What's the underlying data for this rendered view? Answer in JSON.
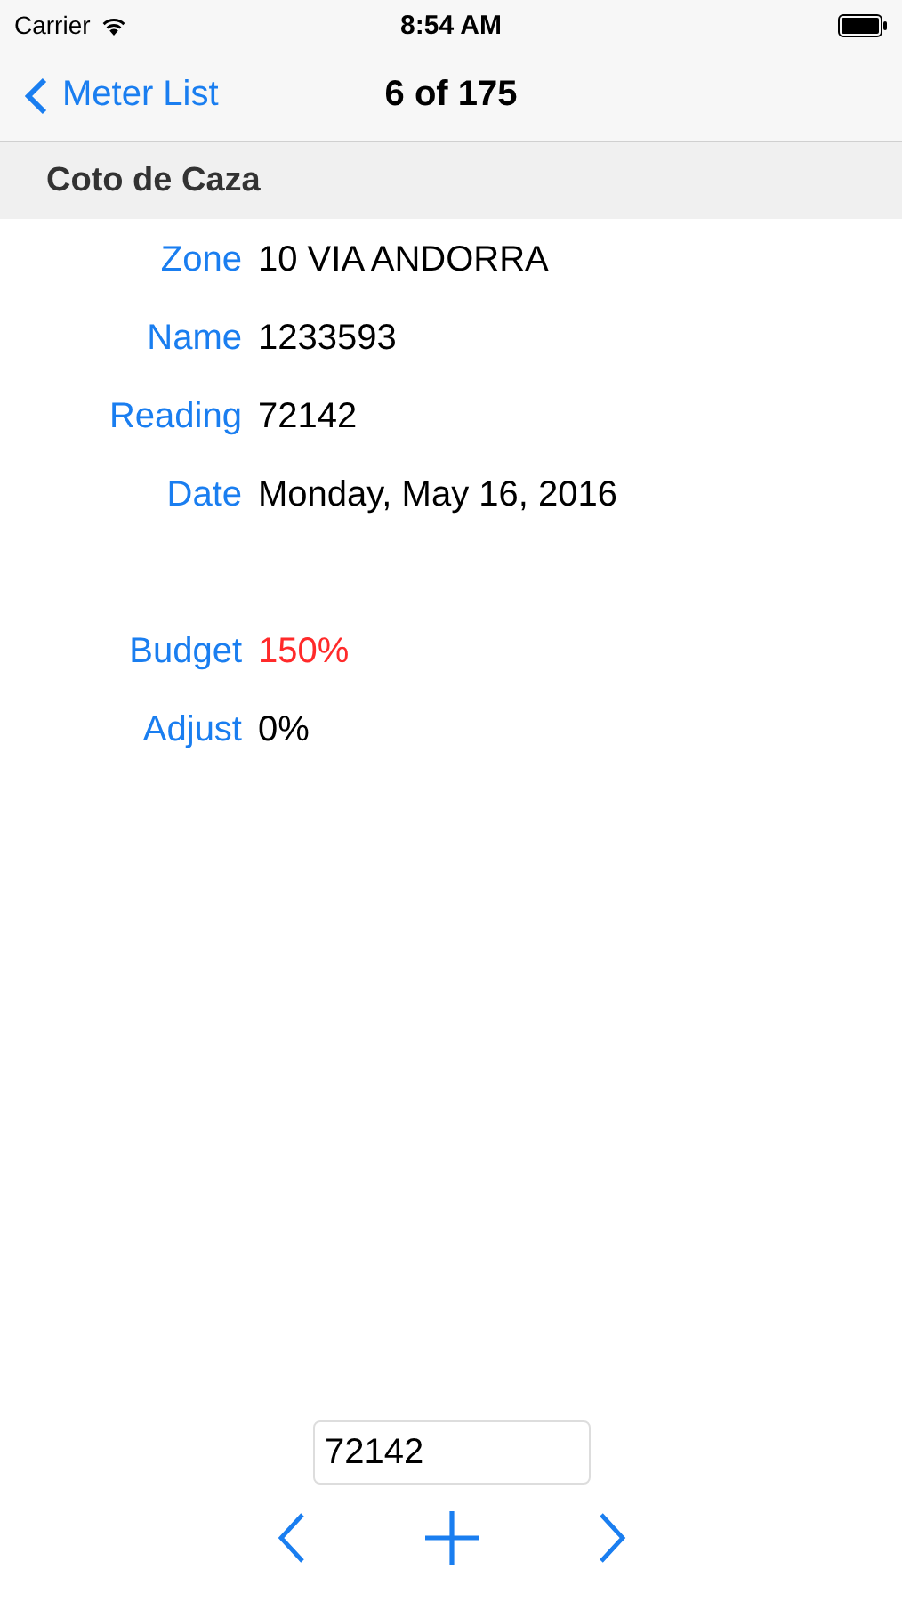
{
  "status_bar": {
    "carrier": "Carrier",
    "time": "8:54 AM"
  },
  "nav_bar": {
    "back_label": "Meter List",
    "title": "6 of 175"
  },
  "section_header": "Coto de Caza",
  "field_groups": [
    {
      "fields": [
        {
          "label": "Zone",
          "value": "10 VIA ANDORRA",
          "color": "#000000"
        },
        {
          "label": "Name",
          "value": "1233593",
          "color": "#000000"
        },
        {
          "label": "Reading",
          "value": "72142",
          "color": "#000000"
        },
        {
          "label": "Date",
          "value": "Monday, May 16, 2016",
          "color": "#000000"
        }
      ]
    },
    {
      "fields": [
        {
          "label": "Budget",
          "value": "150%",
          "color": "#ff2a2a"
        },
        {
          "label": "Adjust",
          "value": "0%",
          "color": "#000000"
        }
      ]
    }
  ],
  "reading_input": {
    "value": "72142"
  }
}
